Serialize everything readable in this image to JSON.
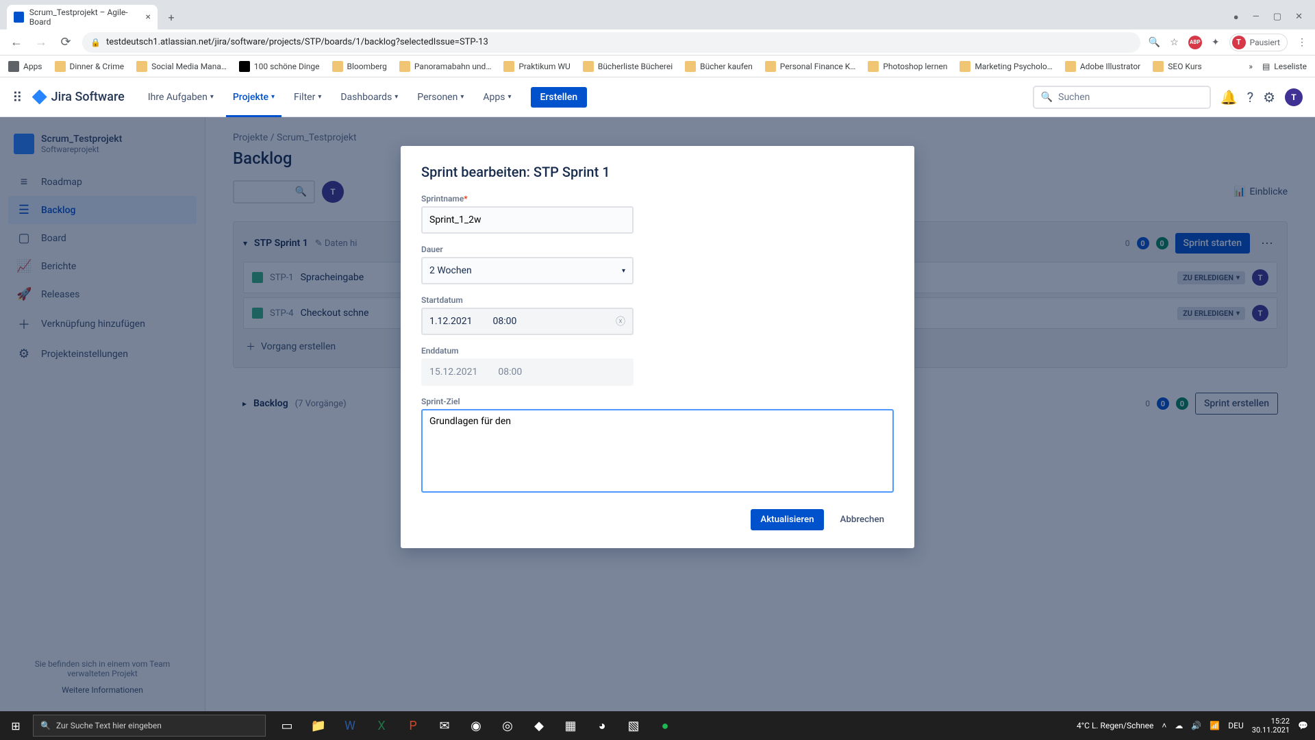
{
  "browser": {
    "tab_title": "Scrum_Testprojekt – Agile-Board",
    "url": "testdeutsch1.atlassian.net/jira/software/projects/STP/boards/1/backlog?selectedIssue=STP-13",
    "user_status": "Pausiert",
    "bookmarks": [
      "Apps",
      "Dinner & Crime",
      "Social Media Mana…",
      "100 schöne Dinge",
      "Bloomberg",
      "Panoramabahn und…",
      "Praktikum WU",
      "Bücherliste Bücherei",
      "Bücher kaufen",
      "Personal Finance K…",
      "Photoshop lernen",
      "Marketing Psycholo…",
      "Adobe Illustrator",
      "SEO Kurs"
    ],
    "reading_list": "Leseliste"
  },
  "jira_nav": {
    "logo": "Jira Software",
    "items": [
      "Ihre Aufgaben",
      "Projekte",
      "Filter",
      "Dashboards",
      "Personen",
      "Apps"
    ],
    "active_index": 1,
    "create": "Erstellen",
    "search_placeholder": "Suchen"
  },
  "sidebar": {
    "project_name": "Scrum_Testprojekt",
    "project_type": "Softwareprojekt",
    "items": [
      {
        "icon": "≡",
        "label": "Roadmap"
      },
      {
        "icon": "☰",
        "label": "Backlog"
      },
      {
        "icon": "▢",
        "label": "Board"
      },
      {
        "icon": "📈",
        "label": "Berichte"
      },
      {
        "icon": "🚀",
        "label": "Releases"
      },
      {
        "icon": "＋",
        "label": "Verknüpfung hinzufügen"
      },
      {
        "icon": "⚙",
        "label": "Projekteinstellungen"
      }
    ],
    "active_index": 1,
    "footer1": "Sie befinden sich in einem vom Team verwalteten Projekt",
    "footer2": "Weitere Informationen"
  },
  "page": {
    "breadcrumb": "Projekte  /  Scrum_Testprojekt",
    "title": "Backlog",
    "einblicke": "Einblicke",
    "sprint": {
      "name": "STP Sprint 1",
      "edit_hint": "Daten hi",
      "count0": "0",
      "badge_blue": "0",
      "badge_green": "0",
      "start_btn": "Sprint starten",
      "issues": [
        {
          "key": "STP-1",
          "summary": "Spracheingabe",
          "status": "ZU ERLEDIGEN"
        },
        {
          "key": "STP-4",
          "summary": "Checkout schne",
          "status": "ZU ERLEDIGEN"
        }
      ],
      "create_issue": "Vorgang erstellen"
    },
    "backlog": {
      "title": "Backlog",
      "count": "(7 Vorgänge)",
      "count0": "0",
      "badge_blue": "0",
      "badge_green": "0",
      "create_btn": "Sprint erstellen"
    }
  },
  "modal": {
    "title": "Sprint bearbeiten: STP Sprint 1",
    "sprintname_label": "Sprintname",
    "sprintname_value": "Sprint_1_2w",
    "dauer_label": "Dauer",
    "dauer_value": "2 Wochen",
    "start_label": "Startdatum",
    "start_date": "1.12.2021",
    "start_time": "08:00",
    "end_label": "Enddatum",
    "end_date": "15.12.2021",
    "end_time": "08:00",
    "goal_label": "Sprint-Ziel",
    "goal_value": "Grundlagen für den ",
    "update": "Aktualisieren",
    "cancel": "Abbrechen"
  },
  "taskbar": {
    "search_placeholder": "Zur Suche Text hier eingeben",
    "weather": "4°C  L. Regen/Schnee",
    "lang": "DEU",
    "time": "15:22",
    "date": "30.11.2021"
  }
}
